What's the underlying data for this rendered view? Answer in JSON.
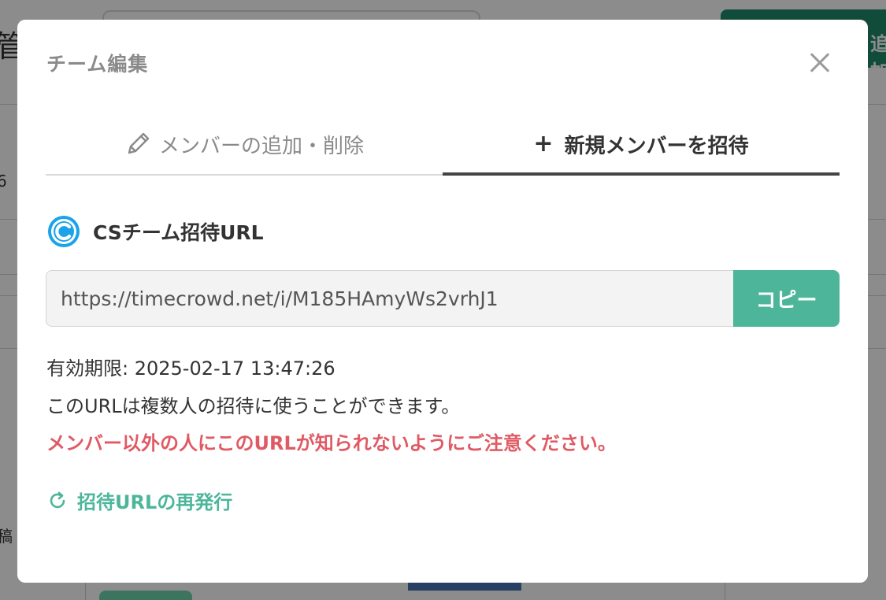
{
  "background": {
    "heading": "管",
    "add_button_label": "追加",
    "side_text_1": "6",
    "side_text_2": "稿"
  },
  "modal": {
    "title": "チーム編集",
    "close_icon": "close-icon",
    "tabs": [
      {
        "label": "メンバーの追加・削除",
        "icon": "pencil-icon",
        "active": false
      },
      {
        "label": "新規メンバーを招待",
        "icon": "plus-icon",
        "active": true
      }
    ],
    "team": {
      "logo": "timecrowd-logo-icon",
      "name": "CSチーム招待URL"
    },
    "invite_url": "https://timecrowd.net/i/M185HAmyWs2vrhJ1",
    "copy_label": "コピー",
    "expiry_label": "有効期限: 2025-02-17 13:47:26",
    "multi_use_note": "このURLは複数人の招待に使うことができます。",
    "warning": "メンバー以外の人にこのURLが知られないようにご注意ください。",
    "reissue_label": "招待URLの再発行",
    "reissue_icon": "refresh-icon"
  },
  "colors": {
    "accent": "#4db69a",
    "warning": "#e05a64",
    "logo": "#1aa3e8"
  }
}
